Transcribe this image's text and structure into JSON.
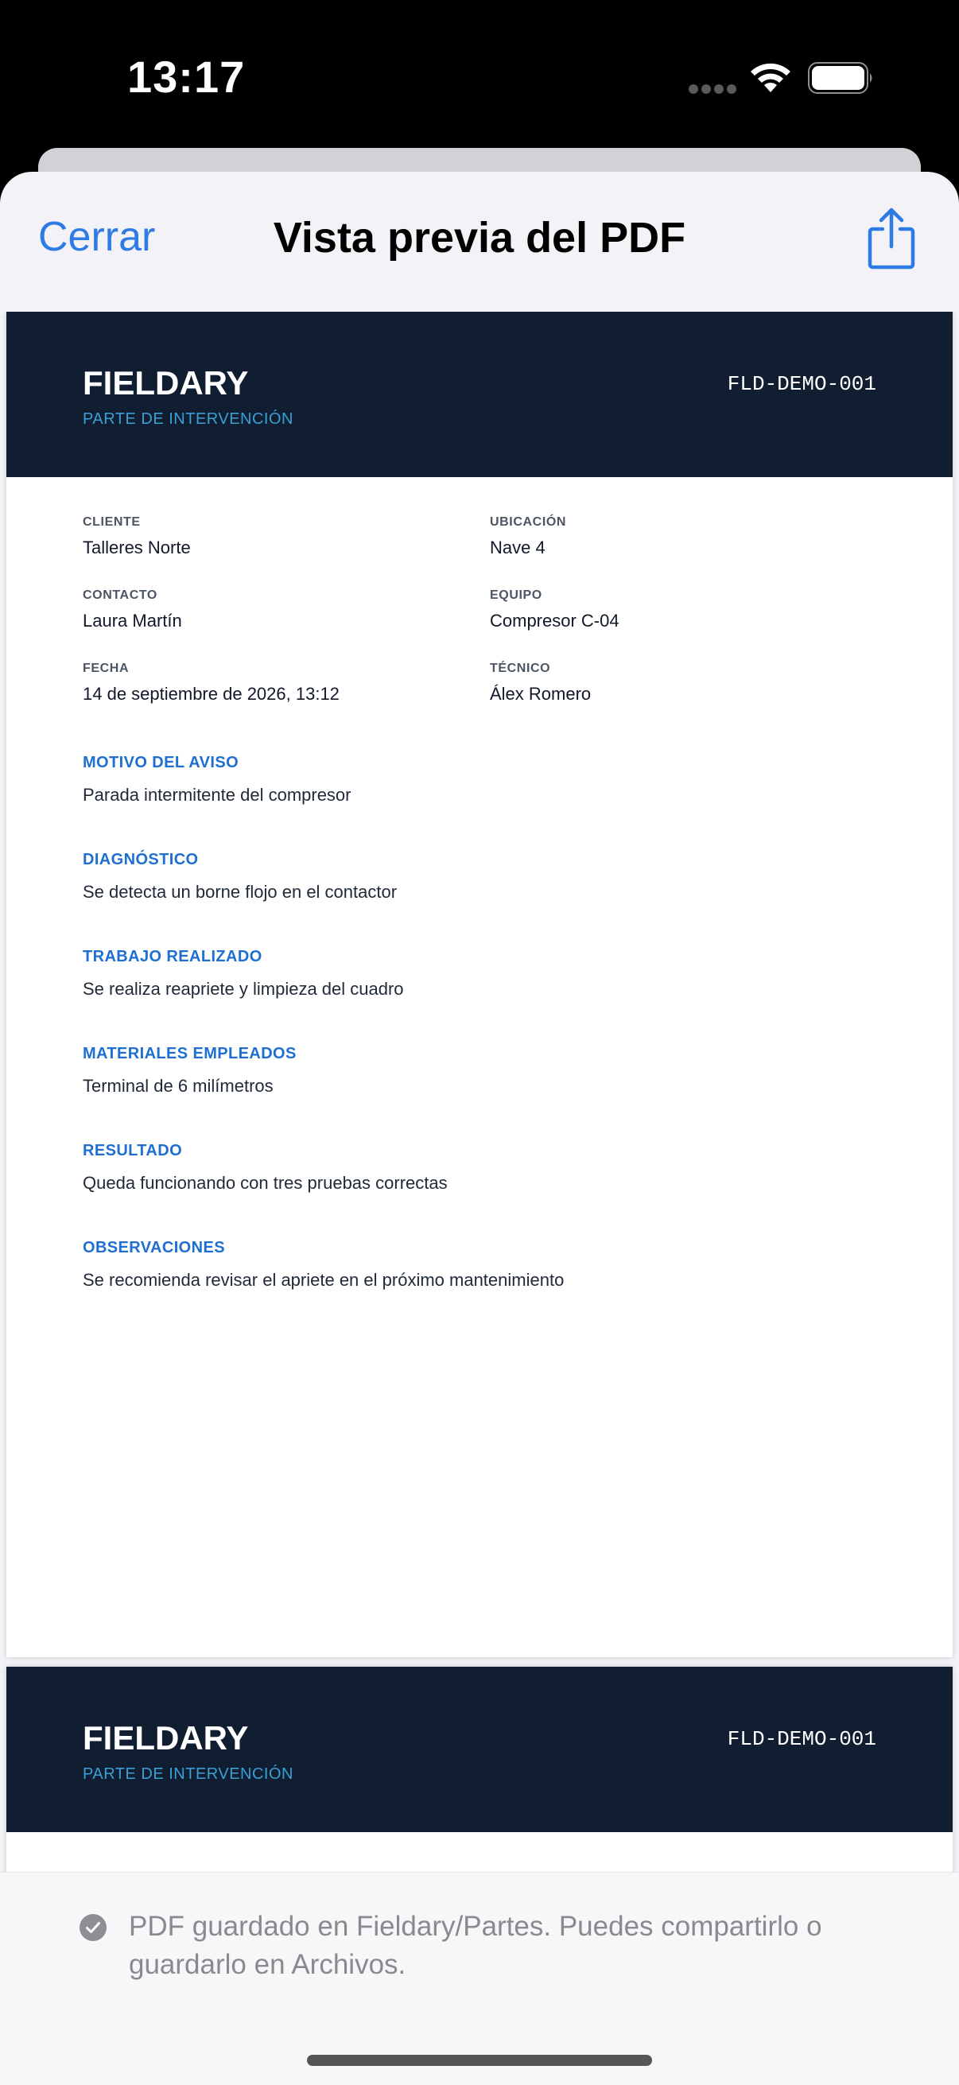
{
  "status_bar": {
    "time": "13:17"
  },
  "nav": {
    "close_label": "Cerrar",
    "title": "Vista previa del PDF",
    "share_icon": "share-icon"
  },
  "pdf": {
    "pages": [
      {
        "brand": "FIELDARY",
        "doc_type": "PARTE DE INTERVENCIÓN",
        "doc_id": "FLD-DEMO-001",
        "fields": [
          {
            "label": "CLIENTE",
            "value": "Talleres Norte"
          },
          {
            "label": "UBICACIÓN",
            "value": "Nave 4"
          },
          {
            "label": "CONTACTO",
            "value": "Laura Martín"
          },
          {
            "label": "EQUIPO",
            "value": "Compresor C-04"
          },
          {
            "label": "FECHA",
            "value": "14 de septiembre de 2026, 13:12"
          },
          {
            "label": "TÉCNICO",
            "value": "Álex Romero"
          }
        ],
        "sections": [
          {
            "title": "MOTIVO DEL AVISO",
            "body": "Parada intermitente del compresor"
          },
          {
            "title": "DIAGNÓSTICO",
            "body": "Se detecta un borne flojo en el contactor"
          },
          {
            "title": "TRABAJO REALIZADO",
            "body": "Se realiza reapriete y limpieza del cuadro"
          },
          {
            "title": "MATERIALES EMPLEADOS",
            "body": "Terminal de 6 milímetros"
          },
          {
            "title": "RESULTADO",
            "body": "Queda funcionando con tres pruebas correctas"
          },
          {
            "title": "OBSERVACIONES",
            "body": "Se recomienda revisar el apriete en el próximo mantenimiento"
          }
        ]
      },
      {
        "brand": "FIELDARY",
        "doc_type": "PARTE DE INTERVENCIÓN",
        "doc_id": "FLD-DEMO-001"
      }
    ]
  },
  "footer": {
    "message": "PDF guardado en Fieldary/Partes. Puedes compartirlo o guardarlo en Archivos.",
    "icon": "checkmark-circle-icon"
  },
  "colors": {
    "accent": "#2f7be5",
    "pdf_header_bg": "#111d31",
    "doc_type": "#3a9fd6",
    "section_title": "#1e6fd1"
  }
}
